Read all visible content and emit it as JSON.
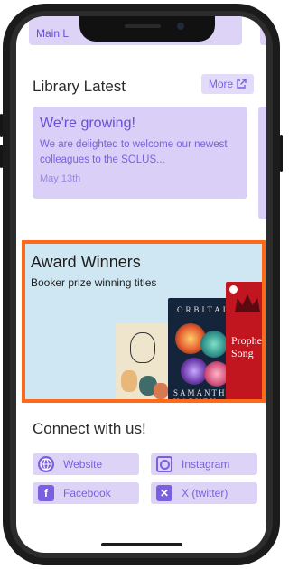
{
  "top_card": {
    "label": "Main L"
  },
  "library": {
    "title": "Library Latest",
    "more_label": "More",
    "news": {
      "title": "We're growing!",
      "body": "We are delighted to welcome our newest colleagues to the SOLUS...",
      "date": "May 13th"
    }
  },
  "banner": {
    "title": "Award Winners",
    "subtitle": "Booker prize winning titles",
    "books": [
      {
        "cover_text": ""
      },
      {
        "cover_top": "ORBITAL",
        "cover_bottom": "SAMANTH HARVEY"
      },
      {
        "cover_text": "Prophet Song"
      }
    ]
  },
  "connect": {
    "title": "Connect with us!",
    "links": {
      "website": "Website",
      "instagram": "Instagram",
      "facebook": "Facebook",
      "x": "X (twitter)"
    }
  },
  "colors": {
    "accent": "#7a5fe0",
    "card_bg": "#dcd3f7",
    "highlight": "#ff6a1a"
  }
}
